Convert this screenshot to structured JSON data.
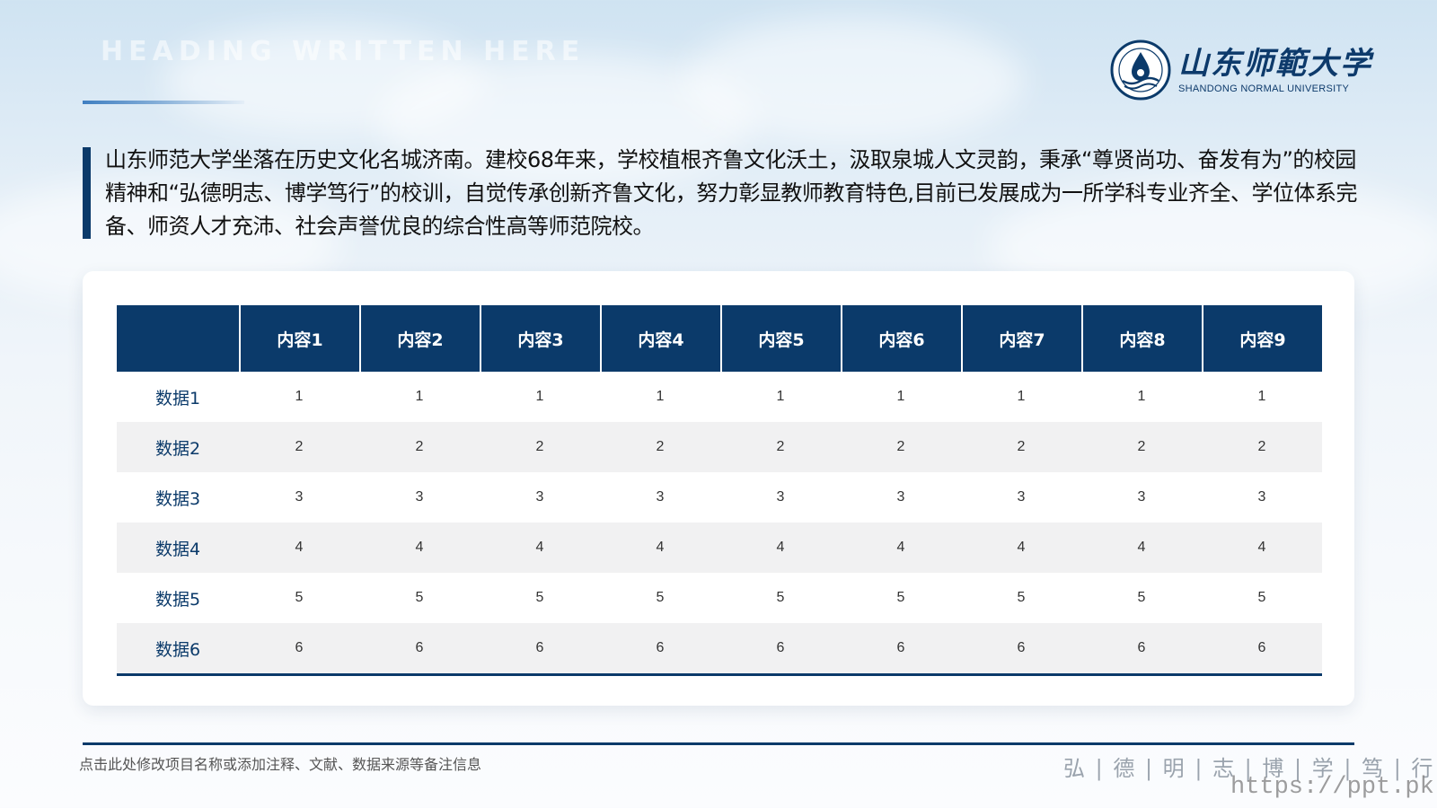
{
  "header": {
    "faded_heading": "HEADING WRITTEN HERE",
    "logo_cn": "山东师範大学",
    "logo_en": "SHANDONG NORMAL UNIVERSITY"
  },
  "intro": {
    "text": "山东师范大学坐落在历史文化名城济南。建校68年来，学校植根齐鲁文化沃土，汲取泉城人文灵韵，秉承“尊贤尚功、奋发有为”的校园精神和“弘德明志、博学笃行”的校训，自觉传承创新齐鲁文化，努力彰显教师教育特色,目前已发展成为一所学科专业齐全、学位体系完备、师资人才充沛、社会声誉优良的综合性高等师范院校。"
  },
  "table": {
    "headers": [
      "",
      "内容1",
      "内容2",
      "内容3",
      "内容4",
      "内容5",
      "内容6",
      "内容7",
      "内容8",
      "内容9"
    ],
    "rows": [
      [
        "数据1",
        "1",
        "1",
        "1",
        "1",
        "1",
        "1",
        "1",
        "1",
        "1"
      ],
      [
        "数据2",
        "2",
        "2",
        "2",
        "2",
        "2",
        "2",
        "2",
        "2",
        "2"
      ],
      [
        "数据3",
        "3",
        "3",
        "3",
        "3",
        "3",
        "3",
        "3",
        "3",
        "3"
      ],
      [
        "数据4",
        "4",
        "4",
        "4",
        "4",
        "4",
        "4",
        "4",
        "4",
        "4"
      ],
      [
        "数据5",
        "5",
        "5",
        "5",
        "5",
        "5",
        "5",
        "5",
        "5",
        "5"
      ],
      [
        "数据6",
        "6",
        "6",
        "6",
        "6",
        "6",
        "6",
        "6",
        "6",
        "6"
      ]
    ]
  },
  "footer": {
    "note": "点击此处修改项目名称或添加注释、文献、数据来源等备注信息",
    "motto": "弘 | 德 | 明 | 志 | 博 | 学 | 笃 | 行",
    "watermark": "https://ppt.pkll.de"
  },
  "colors": {
    "primary": "#0b3a6a",
    "row_alt": "#f1f1f2",
    "motto": "#9aa3ad"
  },
  "icons": [
    "university-emblem-icon"
  ]
}
